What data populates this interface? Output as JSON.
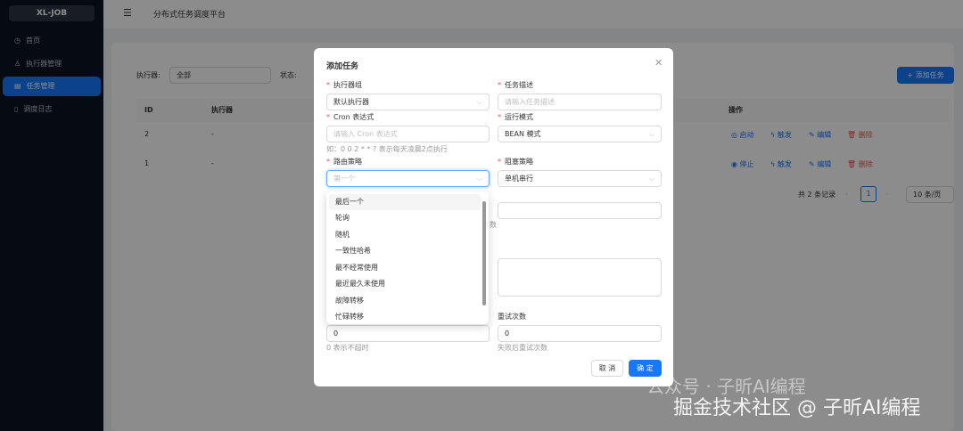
{
  "sidebar": {
    "logo": "XL-JOB",
    "items": [
      {
        "label": "首页",
        "icon": "dashboard-icon"
      },
      {
        "label": "执行器管理",
        "icon": "cluster-icon"
      },
      {
        "label": "任务管理",
        "icon": "schedule-icon",
        "active": true
      },
      {
        "label": "调度日志",
        "icon": "file-icon"
      }
    ]
  },
  "header": {
    "title": "分布式任务调度平台"
  },
  "filters": {
    "executor_label": "执行器:",
    "executor_value": "全部",
    "status_label": "状态:"
  },
  "add_button": "+ 添加任务",
  "table": {
    "headers": {
      "id": "ID",
      "executor": "执行器",
      "action": "操作"
    },
    "rows": [
      {
        "id": "2",
        "executor": "-",
        "toggle": "启动",
        "trigger": "触发",
        "edit": "编辑",
        "delete": "删除"
      },
      {
        "id": "1",
        "executor": "-",
        "toggle": "停止",
        "trigger": "触发",
        "edit": "编辑",
        "delete": "删除"
      }
    ]
  },
  "pagination": {
    "total": "共 2 条记录",
    "page": "1",
    "page_size": "10 条/页"
  },
  "modal": {
    "title": "添加任务",
    "executor_group_label": "执行器组",
    "executor_group_value": "默认执行器",
    "desc_label": "任务描述",
    "desc_placeholder": "请输入任务描述",
    "cron_label": "Cron 表达式",
    "cron_placeholder": "请输入 Cron 表达式",
    "cron_hint": "如：0 0 2 * * ? 表示每天凌晨2点执行",
    "run_mode_label": "运行模式",
    "run_mode_value": "BEAN 模式",
    "route_label": "路由策略",
    "route_placeholder": "第一个",
    "block_label": "阻塞策略",
    "block_value": "单机串行",
    "partial_hint": "数",
    "retry_label": "重试次数",
    "timeout_value": "0",
    "timeout_hint": "0 表示不超时",
    "retry_value": "0",
    "retry_hint": "失败后重试次数",
    "cancel": "取 消",
    "ok": "确 定"
  },
  "dropdown": {
    "options": [
      "最后一个",
      "轮询",
      "随机",
      "一致性哈希",
      "最不经常使用",
      "最近最久未使用",
      "故障转移",
      "忙碌转移"
    ]
  },
  "watermark": {
    "line1": "公众号 · 子昕AI编程",
    "line2": "掘金技术社区 @ 子昕AI编程"
  }
}
